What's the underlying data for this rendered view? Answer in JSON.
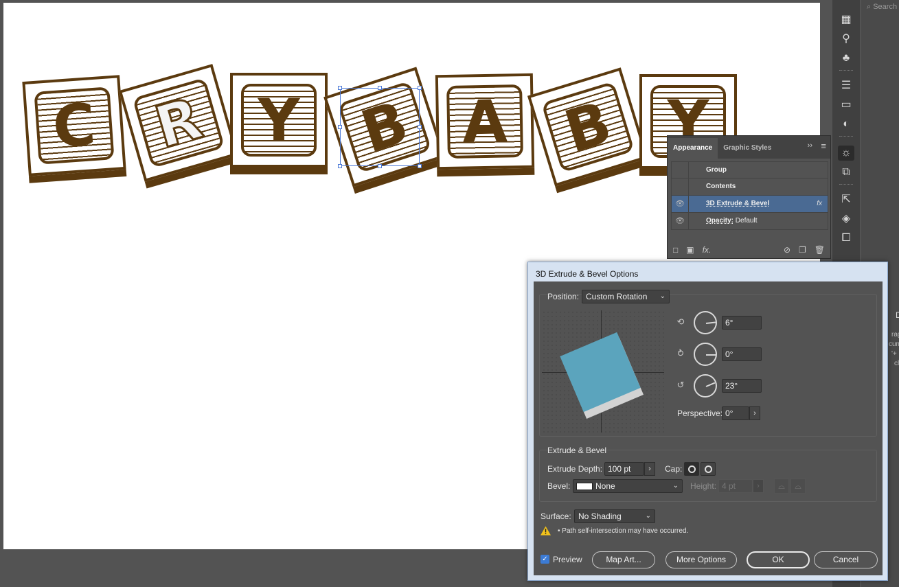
{
  "canvas": {
    "letters": [
      "C",
      "R",
      "Y",
      "B",
      "A",
      "B",
      "Y"
    ]
  },
  "right_panel": {
    "search_placeholder": "Search",
    "fragments": [
      "D",
      "rag",
      "cum",
      "'+",
      "cl"
    ]
  },
  "appearance_panel": {
    "tabs": [
      "Appearance",
      "Graphic Styles"
    ],
    "rows": [
      {
        "label": "Group"
      },
      {
        "label": "Contents"
      },
      {
        "label": "3D Extrude & Bevel",
        "fx": "fx"
      },
      {
        "label": "Opacity:",
        "value": "Default"
      }
    ]
  },
  "dialog": {
    "title": "3D Extrude & Bevel Options",
    "position_label": "Position:",
    "position_value": "Custom Rotation",
    "rotation_x": "6°",
    "rotation_y": "0°",
    "rotation_z": "23°",
    "perspective_label": "Perspective:",
    "perspective_value": "0°",
    "extrude_section": "Extrude & Bevel",
    "extrude_depth_label": "Extrude Depth:",
    "extrude_depth_value": "100 pt",
    "cap_label": "Cap:",
    "bevel_label": "Bevel:",
    "bevel_value": "None",
    "height_label": "Height:",
    "height_value": "4 pt",
    "surface_label": "Surface:",
    "surface_value": "No Shading",
    "warning": "• Path self-intersection may have occurred.",
    "preview_label": "Preview",
    "map_art_label": "Map Art...",
    "more_options_label": "More Options",
    "ok_label": "OK",
    "cancel_label": "Cancel"
  },
  "colors": {
    "block_brown": "#5b3a0f",
    "cube_face": "#5ba4bd",
    "selection_blue": "#4a78d6",
    "panel_selected_row": "#4a6a93"
  }
}
